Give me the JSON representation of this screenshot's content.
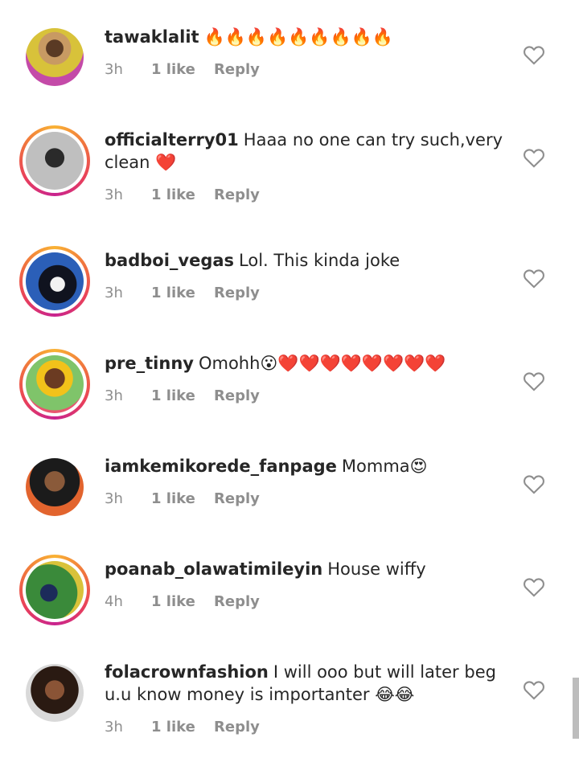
{
  "comments": [
    {
      "username": "tawaklalit",
      "text": "🔥🔥🔥🔥🔥🔥🔥🔥🔥",
      "time": "3h",
      "likes": "1 like",
      "reply": "Reply",
      "story_ring": false
    },
    {
      "username": "officialterry01",
      "text": "Haaa no one can try such,very clean ❤️",
      "time": "3h",
      "likes": "1 like",
      "reply": "Reply",
      "story_ring": true
    },
    {
      "username": "badboi_vegas",
      "text": "Lol. This kinda joke",
      "time": "3h",
      "likes": "1 like",
      "reply": "Reply",
      "story_ring": true
    },
    {
      "username": "pre_tinny",
      "text": "Omohh😮❤️❤️❤️❤️❤️❤️❤️❤️",
      "time": "3h",
      "likes": "1 like",
      "reply": "Reply",
      "story_ring": true
    },
    {
      "username": "iamkemikorede_fanpage",
      "text": "Momma😍",
      "time": "3h",
      "likes": "1 like",
      "reply": "Reply",
      "story_ring": false
    },
    {
      "username": "poanab_olawatimileyin",
      "text": "House wiffy",
      "time": "4h",
      "likes": "1 like",
      "reply": "Reply",
      "story_ring": true
    },
    {
      "username": "folacrownfashion",
      "text": "I will ooo but will later beg u.u know money is importanter 😂😂",
      "time": "3h",
      "likes": "1 like",
      "reply": "Reply",
      "story_ring": false
    }
  ],
  "icons": {
    "like": "heart-outline-icon"
  },
  "colors": {
    "text": "#262626",
    "meta": "#8e8e8e",
    "ring_start": "#f9b234",
    "ring_end": "#c8238f"
  }
}
